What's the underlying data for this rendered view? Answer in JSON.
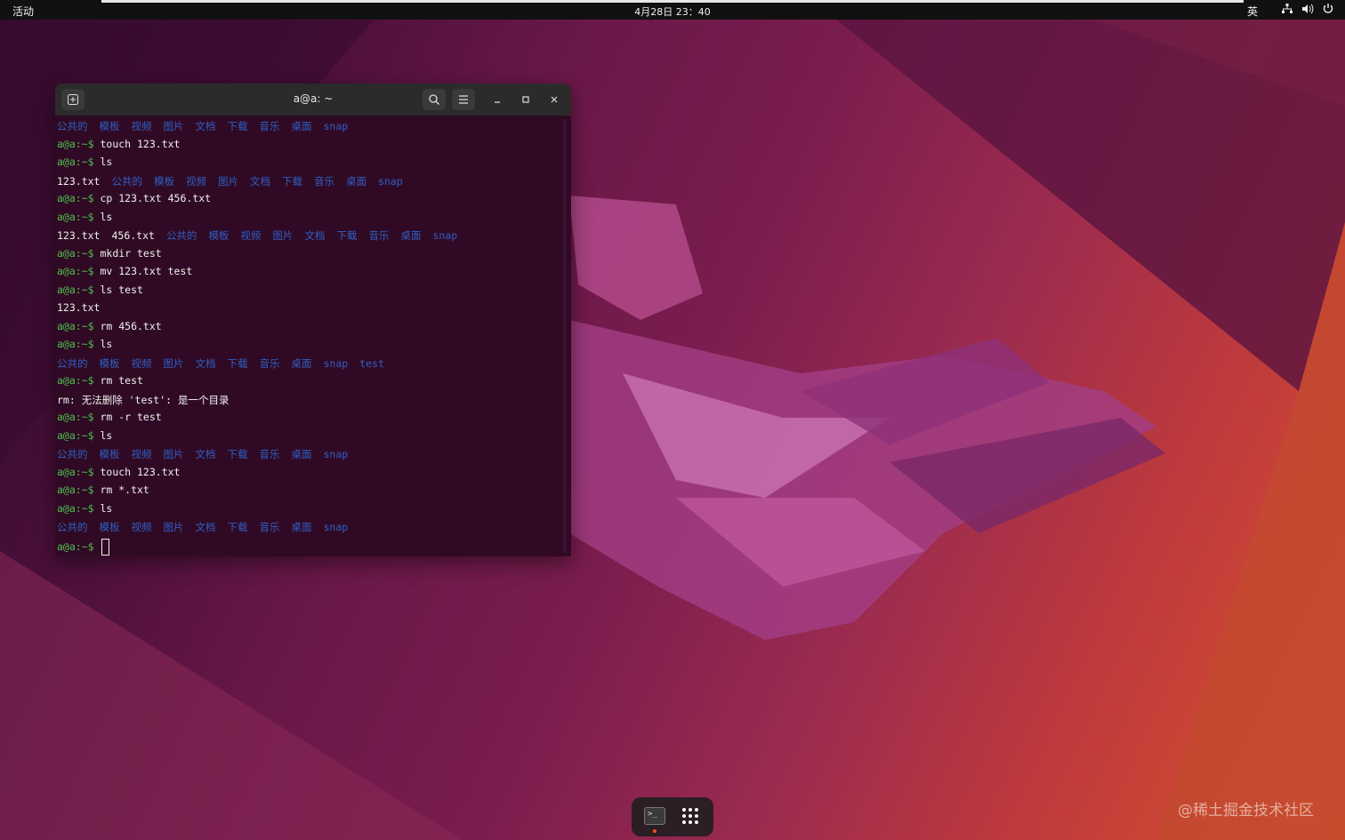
{
  "topbar": {
    "activities": "活动",
    "clock": "4月28日 23：40",
    "input_method": "英",
    "tray_icons": [
      "network-icon",
      "volume-icon",
      "power-icon"
    ]
  },
  "terminal": {
    "title": "a@a: ~",
    "prompt": "a@a:~$",
    "lines": [
      {
        "kind": "dirs",
        "items": [
          [
            "公共的",
            "dir"
          ],
          [
            "模板",
            "dir"
          ],
          [
            "视频",
            "dir"
          ],
          [
            "图片",
            "dir"
          ],
          [
            "文档",
            "dir"
          ],
          [
            "下载",
            "dir"
          ],
          [
            "音乐",
            "dir"
          ],
          [
            "桌面",
            "dir"
          ],
          [
            "snap",
            "dir"
          ]
        ]
      },
      {
        "kind": "cmd",
        "text": "touch 123.txt"
      },
      {
        "kind": "cmd",
        "text": "ls"
      },
      {
        "kind": "dirs",
        "items": [
          [
            "123.txt",
            "out"
          ],
          [
            "公共的",
            "dir"
          ],
          [
            "模板",
            "dir"
          ],
          [
            "视频",
            "dir"
          ],
          [
            "图片",
            "dir"
          ],
          [
            "文档",
            "dir"
          ],
          [
            "下载",
            "dir"
          ],
          [
            "音乐",
            "dir"
          ],
          [
            "桌面",
            "dir"
          ],
          [
            "snap",
            "dir"
          ]
        ]
      },
      {
        "kind": "cmd",
        "text": "cp 123.txt 456.txt"
      },
      {
        "kind": "cmd",
        "text": "ls"
      },
      {
        "kind": "dirs",
        "items": [
          [
            "123.txt",
            "out"
          ],
          [
            "456.txt",
            "out"
          ],
          [
            "公共的",
            "dir"
          ],
          [
            "模板",
            "dir"
          ],
          [
            "视频",
            "dir"
          ],
          [
            "图片",
            "dir"
          ],
          [
            "文档",
            "dir"
          ],
          [
            "下载",
            "dir"
          ],
          [
            "音乐",
            "dir"
          ],
          [
            "桌面",
            "dir"
          ],
          [
            "snap",
            "dir"
          ]
        ]
      },
      {
        "kind": "cmd",
        "text": "mkdir test"
      },
      {
        "kind": "cmd",
        "text": "mv 123.txt test"
      },
      {
        "kind": "cmd",
        "text": "ls test"
      },
      {
        "kind": "text",
        "text": "123.txt"
      },
      {
        "kind": "cmd",
        "text": "rm 456.txt"
      },
      {
        "kind": "cmd",
        "text": "ls"
      },
      {
        "kind": "dirs",
        "items": [
          [
            "公共的",
            "dir"
          ],
          [
            "模板",
            "dir"
          ],
          [
            "视频",
            "dir"
          ],
          [
            "图片",
            "dir"
          ],
          [
            "文档",
            "dir"
          ],
          [
            "下载",
            "dir"
          ],
          [
            "音乐",
            "dir"
          ],
          [
            "桌面",
            "dir"
          ],
          [
            "snap",
            "dir"
          ],
          [
            "test",
            "dir"
          ]
        ]
      },
      {
        "kind": "cmd",
        "text": "rm test"
      },
      {
        "kind": "text",
        "text": "rm: 无法删除 'test': 是一个目录"
      },
      {
        "kind": "cmd",
        "text": "rm -r test"
      },
      {
        "kind": "cmd",
        "text": "ls"
      },
      {
        "kind": "dirs",
        "items": [
          [
            "公共的",
            "dir"
          ],
          [
            "模板",
            "dir"
          ],
          [
            "视频",
            "dir"
          ],
          [
            "图片",
            "dir"
          ],
          [
            "文档",
            "dir"
          ],
          [
            "下载",
            "dir"
          ],
          [
            "音乐",
            "dir"
          ],
          [
            "桌面",
            "dir"
          ],
          [
            "snap",
            "dir"
          ]
        ]
      },
      {
        "kind": "cmd",
        "text": "touch 123.txt"
      },
      {
        "kind": "cmd",
        "text": "rm *.txt"
      },
      {
        "kind": "cmd",
        "text": "ls"
      },
      {
        "kind": "dirs",
        "items": [
          [
            "公共的",
            "dir"
          ],
          [
            "模板",
            "dir"
          ],
          [
            "视频",
            "dir"
          ],
          [
            "图片",
            "dir"
          ],
          [
            "文档",
            "dir"
          ],
          [
            "下载",
            "dir"
          ],
          [
            "音乐",
            "dir"
          ],
          [
            "桌面",
            "dir"
          ],
          [
            "snap",
            "dir"
          ]
        ]
      },
      {
        "kind": "input",
        "text": ""
      }
    ],
    "colors": {
      "prompt": "#4ec04e",
      "dir": "#2f5fc6",
      "background": "#300a24"
    }
  },
  "dock": {
    "terminal_glyph": ">_",
    "items": [
      "terminal-app",
      "show-apps"
    ]
  },
  "watermark": "@稀土掘金技术社区"
}
